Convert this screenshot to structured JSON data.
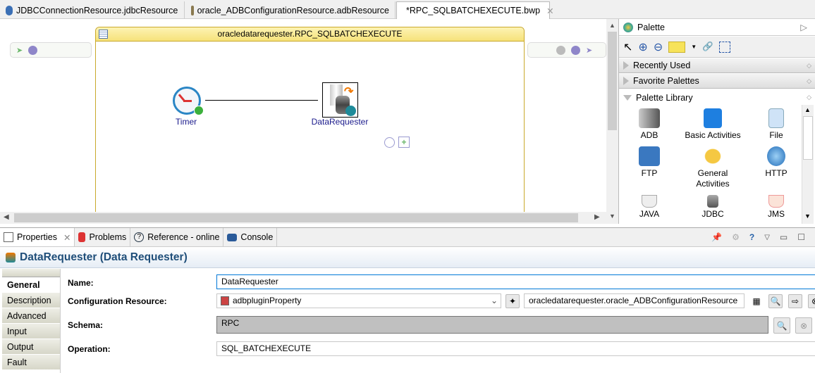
{
  "editor_tabs": [
    {
      "label": "JDBCConnectionResource.jdbcResource"
    },
    {
      "label": "oracle_ADBConfigurationResource.adbResource"
    },
    {
      "label": "*RPC_SQLBATCHEXECUTE.bwp",
      "active": true
    }
  ],
  "process": {
    "title": "oracledatarequester.RPC_SQLBATCHEXECUTE",
    "activities": [
      {
        "label": "Timer"
      },
      {
        "label": "DataRequester"
      }
    ]
  },
  "palette": {
    "title": "Palette",
    "drawers": [
      "Recently Used",
      "Favorite Palettes",
      "Palette Library"
    ],
    "items": [
      "ADB",
      "Basic Activities",
      "File",
      "FTP",
      "General Activities",
      "HTTP",
      "JAVA",
      "JDBC",
      "JMS"
    ]
  },
  "bottom_tabs": [
    "Properties",
    "Problems",
    "Reference - online",
    "Console"
  ],
  "properties": {
    "title": "DataRequester (Data Requester)",
    "side_tabs": [
      "General",
      "Description",
      "Advanced",
      "Input",
      "Output",
      "Fault"
    ],
    "name_label": "Name:",
    "name_value": "DataRequester",
    "config_label": "Configuration Resource:",
    "config_value": "adbpluginProperty",
    "config_resource": "oracledatarequester.oracle_ADBConfigurationResource",
    "schema_label": "Schema:",
    "schema_value": "RPC",
    "operation_label": "Operation:",
    "operation_value": "SQL_BATCHEXECUTE"
  },
  "colors": {
    "accent": "#1f4e79",
    "process_header": "#f6e27a",
    "focus": "#0078d7"
  }
}
